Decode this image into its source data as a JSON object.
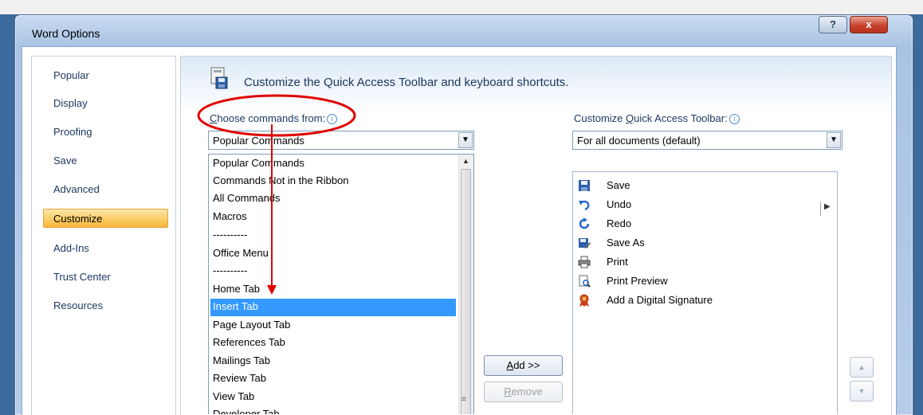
{
  "window": {
    "title": "Word Options",
    "help_glyph": "?",
    "close_glyph": "x"
  },
  "nav": {
    "items": [
      {
        "label": "Popular"
      },
      {
        "label": "Display"
      },
      {
        "label": "Proofing"
      },
      {
        "label": "Save"
      },
      {
        "label": "Advanced"
      },
      {
        "label": "Customize",
        "active": true
      },
      {
        "label": "Add-Ins"
      },
      {
        "label": "Trust Center"
      },
      {
        "label": "Resources"
      }
    ]
  },
  "main": {
    "heading": "Customize the Quick Access Toolbar and keyboard shortcuts.",
    "choose_label_accel": "C",
    "choose_label_rest": "hoose commands from:",
    "choose_value": "Popular Commands",
    "customize_label_pre": "Customize ",
    "customize_label_accel": "Q",
    "customize_label_post": "uick Access Toolbar:",
    "customize_value": "For all documents (default)",
    "info_glyph": "i",
    "dropdown_options": [
      "Popular Commands",
      "Commands Not in the Ribbon",
      "All Commands",
      "Macros",
      "----------",
      "Office Menu",
      "----------",
      "Home Tab",
      "Insert Tab",
      "Page Layout Tab",
      "References Tab",
      "Mailings Tab",
      "Review Tab",
      "View Tab",
      "Developer Tab"
    ],
    "dropdown_selected": "Insert Tab",
    "toolbar_items": [
      {
        "label": "Save",
        "icon": "save-icon"
      },
      {
        "label": "Undo",
        "icon": "undo-icon"
      },
      {
        "label": "Redo",
        "icon": "redo-icon"
      },
      {
        "label": "Save As",
        "icon": "save-as-icon"
      },
      {
        "label": "Print",
        "icon": "print-icon"
      },
      {
        "label": "Print Preview",
        "icon": "print-preview-icon"
      },
      {
        "label": "Add a Digital Signature",
        "icon": "digital-signature-icon"
      }
    ],
    "add_accel": "A",
    "add_rest": "dd >>",
    "remove_accel": "R",
    "remove_rest": "emove",
    "up_glyph": "▲",
    "down_glyph": "▼"
  },
  "colors": {
    "selection": "#3399ff",
    "annotation": "#e00000",
    "nav_active": "#fbcf6a"
  }
}
